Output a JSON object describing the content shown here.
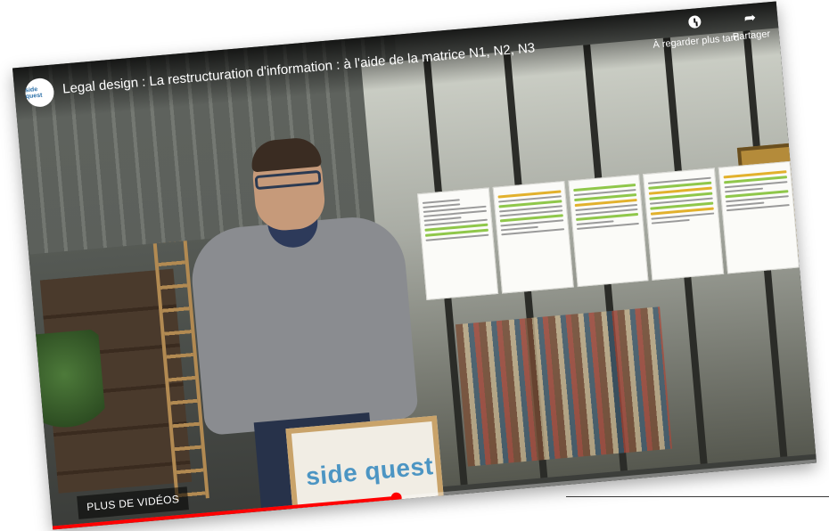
{
  "video": {
    "channel_logo_text": "side quest",
    "title": "Legal design : La restructuration d'information : à l'aide de la matrice N1, N2, N3"
  },
  "actions": {
    "watch_later_label": "À regarder plus tard",
    "watch_later_icon": "clock-icon",
    "share_label": "Partager",
    "share_icon": "share-arrow-icon"
  },
  "more_videos_label": "PLUS DE VIDÉOS",
  "podium_logo": {
    "part1": "side",
    "part2": " quest"
  },
  "progress": {
    "fraction": 0.45
  },
  "colors": {
    "progress": "#ff0000",
    "highlight_green": "#8fc74a",
    "highlight_yellow": "#e2b12c",
    "brand": "#4c95c3"
  }
}
